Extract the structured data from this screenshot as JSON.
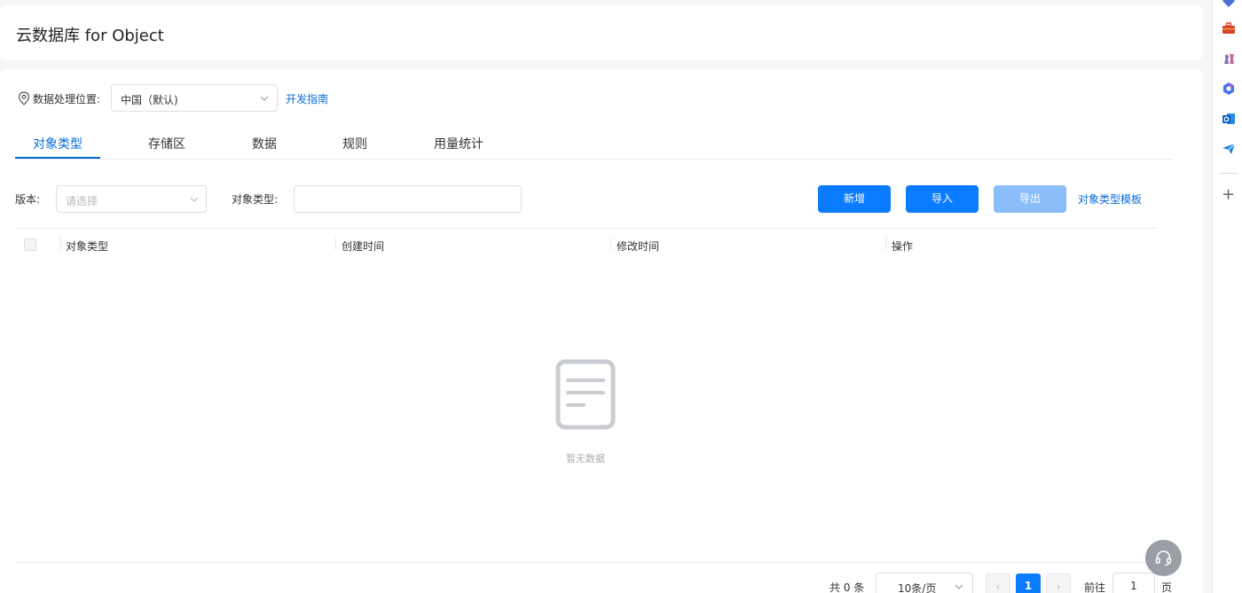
{
  "header": {
    "title": "云数据库 for Object"
  },
  "location": {
    "label": "数据处理位置:",
    "selected": "中国（默认)",
    "guide_link": "开发指南"
  },
  "tabs": [
    {
      "label": "对象类型",
      "active": true
    },
    {
      "label": "存储区",
      "active": false
    },
    {
      "label": "数据",
      "active": false
    },
    {
      "label": "规则",
      "active": false
    },
    {
      "label": "用量统计",
      "active": false
    }
  ],
  "filters": {
    "version_label": "版本:",
    "version_placeholder": "请选择",
    "type_label": "对象类型:",
    "type_value": ""
  },
  "toolbar": {
    "add_label": "新增",
    "import_label": "导入",
    "export_label": "导出",
    "template_link": "对象类型模板"
  },
  "table": {
    "columns": [
      "对象类型",
      "创建时间",
      "修改时间",
      "操作"
    ],
    "rows": [],
    "empty_text": "暂无数据"
  },
  "pagination": {
    "total_text": "共 0 条",
    "page_size": "10条/页",
    "prev": "‹",
    "current_page": "1",
    "next": "›",
    "goto_label": "前往",
    "goto_value": "1",
    "page_suffix": "页"
  },
  "right_rail": {
    "icons": [
      "diamond-icon",
      "toolbox-icon",
      "chess-icon",
      "hexagon-app-icon",
      "outlook-icon",
      "send-icon",
      "plus-icon"
    ],
    "plus_label": "+"
  },
  "colors": {
    "accent": "#0a7cff",
    "link": "#0a6bd8",
    "disabled": "#8bbdfb"
  }
}
